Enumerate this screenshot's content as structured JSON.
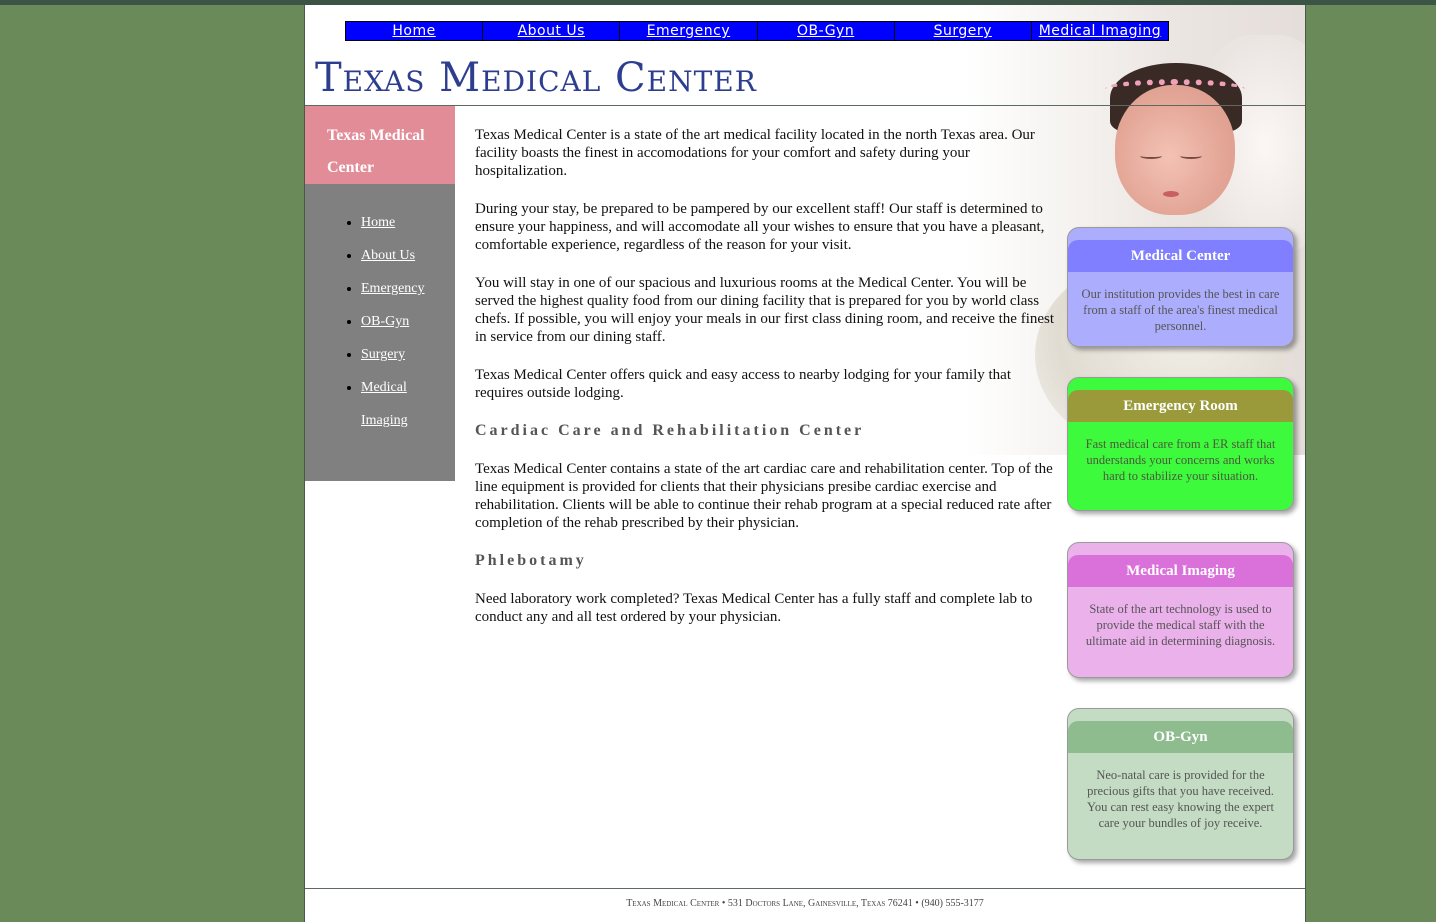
{
  "nav": {
    "items": [
      {
        "label": "Home"
      },
      {
        "label": "About Us"
      },
      {
        "label": "Emergency"
      },
      {
        "label": "OB-Gyn"
      },
      {
        "label": "Surgery"
      },
      {
        "label": "Medical Imaging"
      }
    ]
  },
  "header": {
    "title": "Texas Medical Center"
  },
  "sidebar": {
    "title": "Texas Medical Center",
    "items": [
      {
        "label": "Home"
      },
      {
        "label": "About Us"
      },
      {
        "label": "Emergency"
      },
      {
        "label": "OB-Gyn"
      },
      {
        "label": "Surgery"
      },
      {
        "label": "Medical Imaging"
      }
    ]
  },
  "main": {
    "p1": "Texas Medical Center is a state of the art medical facility located in the north Texas area. Our facility boasts the finest in accomodations for your comfort and safety during your hospitalization.",
    "p2": "During your stay, be prepared to be pampered by our excellent staff! Our staff is determined to ensure your happiness, and will accomodate all your wishes to ensure that you have a pleasant, comfortable experience, regardless of the reason for your visit.",
    "p3": "You will stay in one of our spacious and luxurious rooms at the Medical Center. You will be served the highest quality food from our dining facility that is prepared for you by world class chefs. If possible, you will enjoy your meals in our first class dining room, and receive the finest in service from our dining staff.",
    "p4": "Texas Medical Center offers quick and easy access to nearby lodging for your family that requires outside lodging.",
    "h_cardiac": "Cardiac Care and Rehabilitation Center",
    "p5": "Texas Medical Center contains a state of the art cardiac care and rehabilitation center. Top of the line equipment is provided for clients that their physicians presibe cardiac exercise and rehabilitation. Clients will be able to continue their rehab program at a special reduced rate after completion of the rehab prescribed by their physician.",
    "h_phleb": "Phlebotamy",
    "p6": "Need laboratory work completed? Texas Medical Center has a fully staff and complete lab to conduct any and all test ordered by your physician."
  },
  "boxes": [
    {
      "title": "Medical Center",
      "text": "Our institution provides the best in care from a staff of the area's finest medical personnel."
    },
    {
      "title": "Emergency Room",
      "text": "Fast medical care from a ER staff that understands your concerns and works hard to stabilize your situation."
    },
    {
      "title": "Medical Imaging",
      "text": "State of the art technology is used to provide the medical staff with the ultimate aid in determining diagnosis."
    },
    {
      "title": "OB-Gyn",
      "text": "Neo-natal care is provided for the precious gifts that you have received. You can rest easy knowing the expert care your bundles of joy receive."
    }
  ],
  "footer": {
    "text": "Texas Medical Center • 531 Doctors Lane, Gainesville, Texas 76241 • (940) 555-3177"
  }
}
